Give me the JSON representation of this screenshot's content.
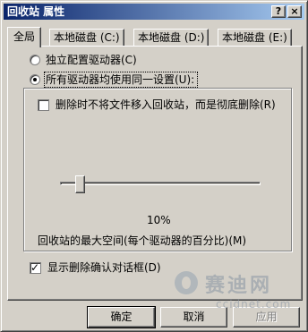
{
  "window": {
    "title": "回收站 属性",
    "help_label": "?",
    "close_label": "×"
  },
  "tabs": [
    {
      "label": "全局",
      "active": true
    },
    {
      "label": "本地磁盘 (C:)",
      "active": false
    },
    {
      "label": "本地磁盘 (D:)",
      "active": false
    },
    {
      "label": "本地磁盘 (E:)",
      "active": false
    }
  ],
  "options": {
    "independent_label": "独立配置驱动器(C)",
    "independent_selected": false,
    "same_label": "所有驱动器均使用同一设置(U):",
    "same_selected": true
  },
  "group": {
    "delete_immediately_label": "删除时不将文件移入回收站，而是彻底删除(R)",
    "delete_immediately_checked": false,
    "slider_value": 0.1,
    "slider_percent_text": "10%",
    "slider_caption": "回收站的最大空间(每个驱动器的百分比)(M)"
  },
  "confirm": {
    "label": "显示删除确认对话框(D)",
    "checked": true
  },
  "buttons": {
    "ok": "确定",
    "cancel": "取消",
    "apply": "应用"
  },
  "watermark": {
    "title": "赛迪网",
    "subtitle": "ccidnet.com"
  }
}
